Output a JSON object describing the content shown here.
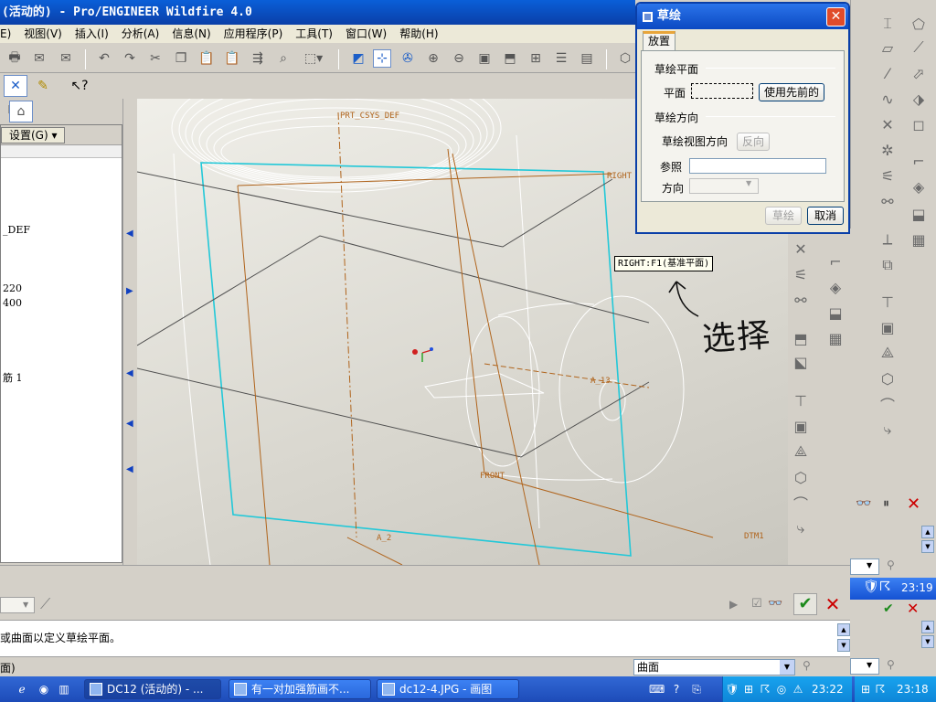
{
  "window": {
    "title": "(活动的) - Pro/ENGINEER Wildfire 4.0"
  },
  "menu": [
    "编辑(E)",
    "视图(V)",
    "插入(I)",
    "分析(A)",
    "信息(N)",
    "应用程序(P)",
    "工具(T)",
    "窗口(W)",
    "帮助(H)"
  ],
  "menu_display": [
    "E)",
    "视图(V)",
    "插入(I)",
    "分析(A)",
    "信息(N)",
    "应用程序(P)",
    "工具(T)",
    "窗口(W)",
    "帮助(H)"
  ],
  "model_tree": {
    "settings_label": "设置(G)",
    "items": [
      "_DEF",
      "220",
      "400",
      "筋 1"
    ]
  },
  "dialog": {
    "title": "草绘",
    "tab": "放置",
    "section_plane": "草绘平面",
    "plane_label": "平面",
    "plane_value": "",
    "use_previous": "使用先前的",
    "section_orientation": "草绘方向",
    "view_dir_label": "草绘视图方向",
    "flip": "反向",
    "reference_label": "参照",
    "reference_value": "",
    "orientation_label": "方向",
    "orientation_value": "",
    "sketch_button": "草绘",
    "cancel_button": "取消"
  },
  "viewport": {
    "tooltip": "RIGHT:F1(基准平面)",
    "labels": [
      "PRT_CSYS_DEF",
      "RIGHT",
      "FRONT",
      "A_2",
      "A_13",
      "DTM1"
    ],
    "annotation": "选择"
  },
  "message": {
    "text": "或曲面以定义草绘平面。"
  },
  "status": {
    "text": "面)",
    "filter": "曲面"
  },
  "taskbar": {
    "tasks": [
      {
        "label": "DC12 (活动的) - ...",
        "active": true
      },
      {
        "label": "有一对加强筋画不...",
        "active": false
      },
      {
        "label": "dc12-4.JPG - 画图",
        "active": false
      }
    ],
    "clock": "23:22",
    "clock_right": "23:18",
    "clock_right2": "23:19"
  },
  "colors": {
    "titlebar": "#0a3fa8",
    "datum": "#b0641c",
    "highlight": "#22c8d8",
    "geometry": "#ffffff"
  }
}
